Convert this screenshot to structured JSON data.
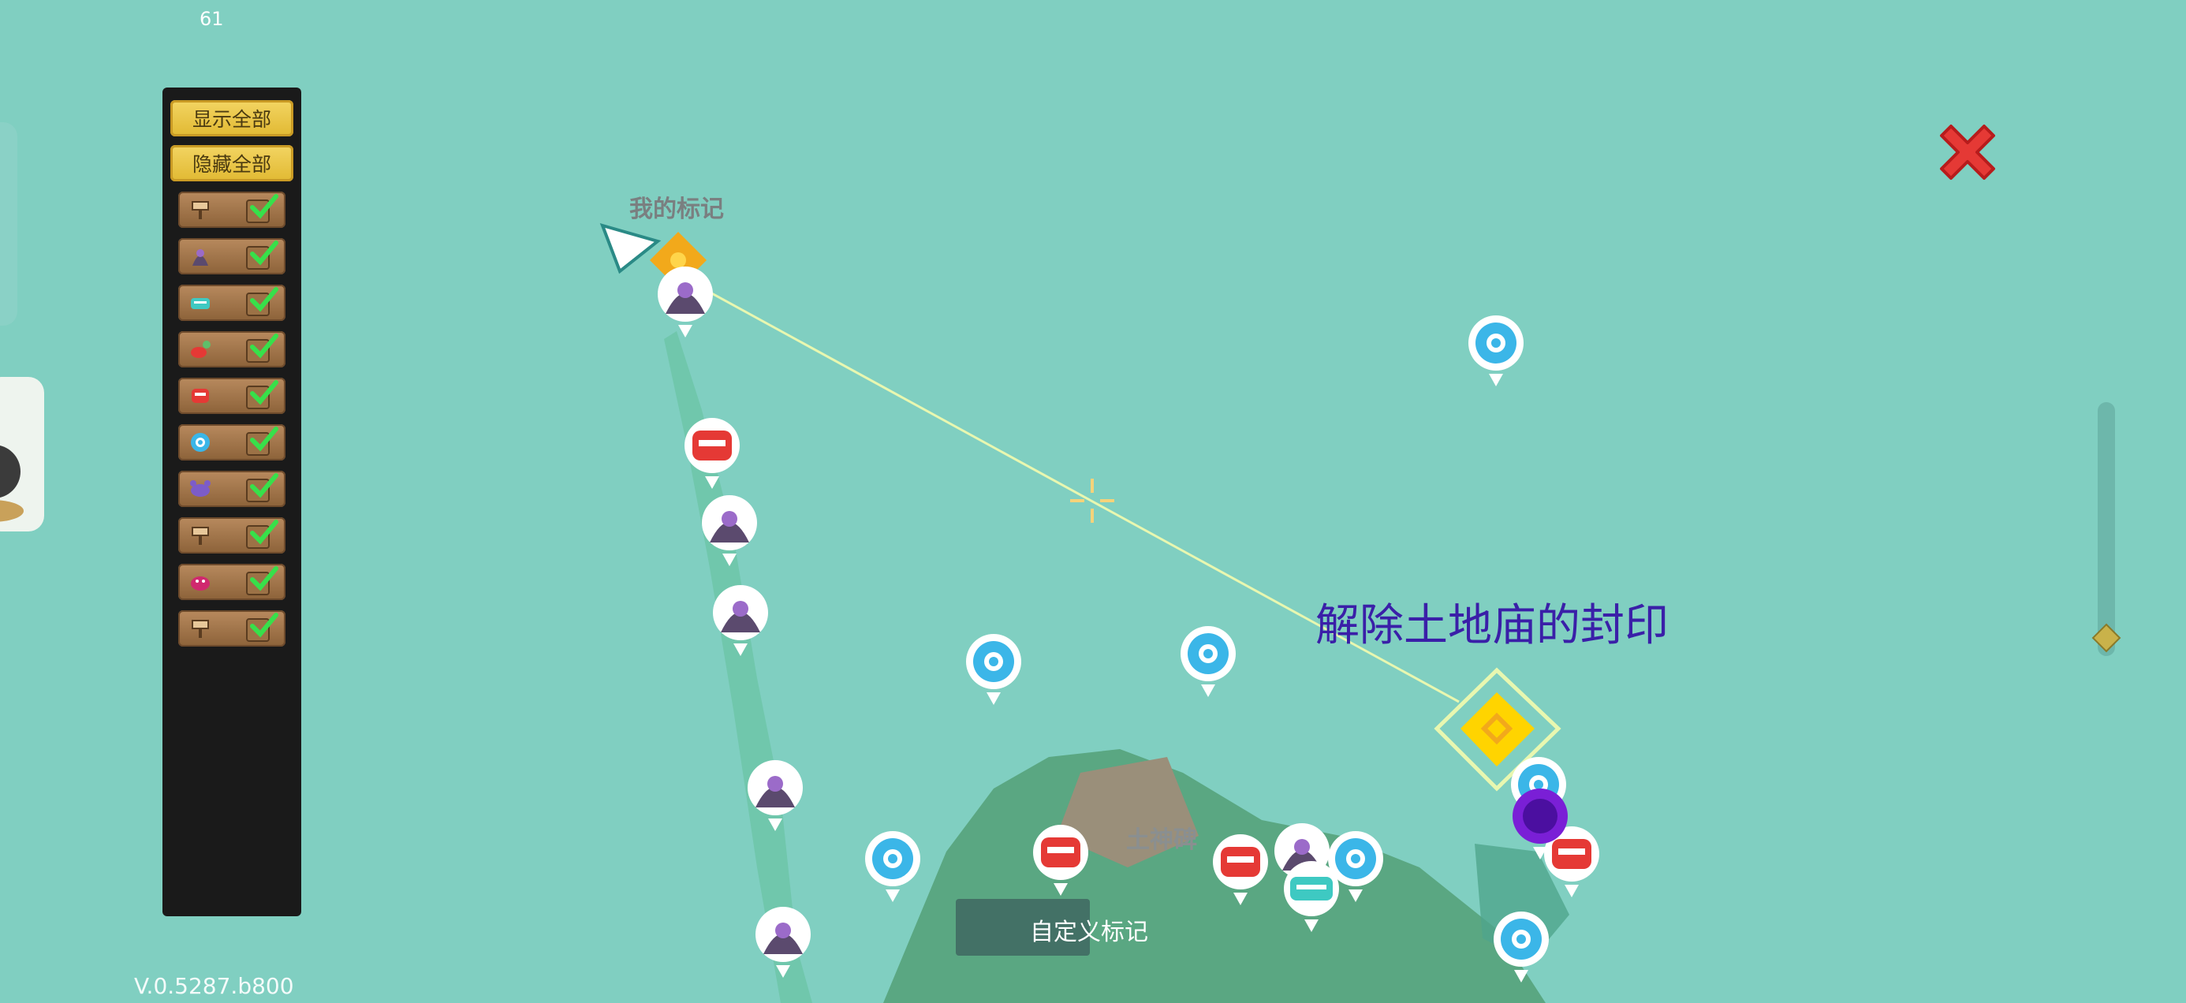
{
  "hud": {
    "fps": "61",
    "version": "V.0.5287.b800"
  },
  "filter_panel": {
    "show_all": "显示全部",
    "hide_all": "隐藏全部",
    "rows": [
      {
        "icon": "signpost-icon",
        "checked": true
      },
      {
        "icon": "hooded-figure-icon",
        "checked": true
      },
      {
        "icon": "teleport-pad-icon",
        "checked": true
      },
      {
        "icon": "red-creature-icon",
        "checked": true
      },
      {
        "icon": "red-monster-icon",
        "checked": true
      },
      {
        "icon": "swirl-portal-icon",
        "checked": true
      },
      {
        "icon": "purple-crab-icon",
        "checked": true
      },
      {
        "icon": "signpost-icon",
        "checked": true
      },
      {
        "icon": "magenta-creature-icon",
        "checked": true
      },
      {
        "icon": "signpost-icon",
        "checked": true
      }
    ]
  },
  "map": {
    "my_marker_label": "我的标记",
    "quest_label": "解除土地庙的封印",
    "landmark_label": "土神碑",
    "custom_marker_button": "自定义标记"
  },
  "colors": {
    "sea": "#80cfc1",
    "quest_text": "#3a1fa8",
    "close": "#e53935",
    "route": "#e8f7b0"
  }
}
